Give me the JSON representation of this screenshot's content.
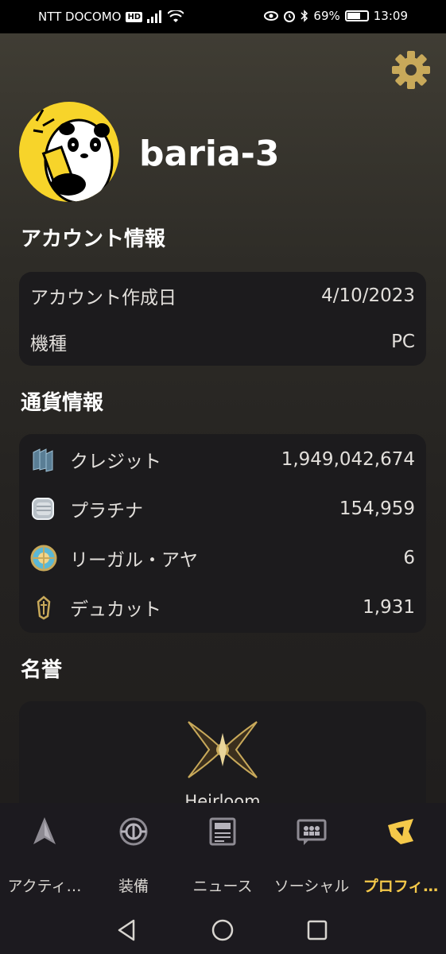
{
  "status_bar": {
    "carrier": "NTT DOCOMO",
    "hd_badge": "HD",
    "battery_text": "69%",
    "battery_level": 0.69,
    "time": "13:09"
  },
  "profile": {
    "username": "baria-3",
    "avatar_icon": "panda-avatar-icon",
    "settings_icon": "gear-icon"
  },
  "account_info": {
    "title": "アカウント情報",
    "rows": [
      {
        "label": "アカウント作成日",
        "value": "4/10/2023"
      },
      {
        "label": "機種",
        "value": "PC"
      }
    ]
  },
  "currency_info": {
    "title": "通貨情報",
    "rows": [
      {
        "icon": "credits-icon",
        "label": "クレジット",
        "value": "1,949,042,674"
      },
      {
        "icon": "platinum-icon",
        "label": "プラチナ",
        "value": "154,959"
      },
      {
        "icon": "regal-aya-icon",
        "label": "リーガル・アヤ",
        "value": "6"
      },
      {
        "icon": "ducats-icon",
        "label": "デュカット",
        "value": "1,931"
      }
    ]
  },
  "honor": {
    "title": "名誉",
    "emblem_icon": "heirloom-emblem-icon",
    "name": "Heirloom"
  },
  "bottom_nav": {
    "items": [
      {
        "icon": "rocket-icon",
        "label": "アクティ…",
        "active": false
      },
      {
        "icon": "loadout-icon",
        "label": "装備",
        "active": false
      },
      {
        "icon": "news-icon",
        "label": "ニュース",
        "active": false
      },
      {
        "icon": "social-icon",
        "label": "ソーシャル",
        "active": false
      },
      {
        "icon": "profile-icon",
        "label": "プロフィ…",
        "active": true
      }
    ]
  },
  "colors": {
    "accent": "#f5c94a",
    "card_bg": "#1c1b1d",
    "gear": "#c8a95a"
  }
}
